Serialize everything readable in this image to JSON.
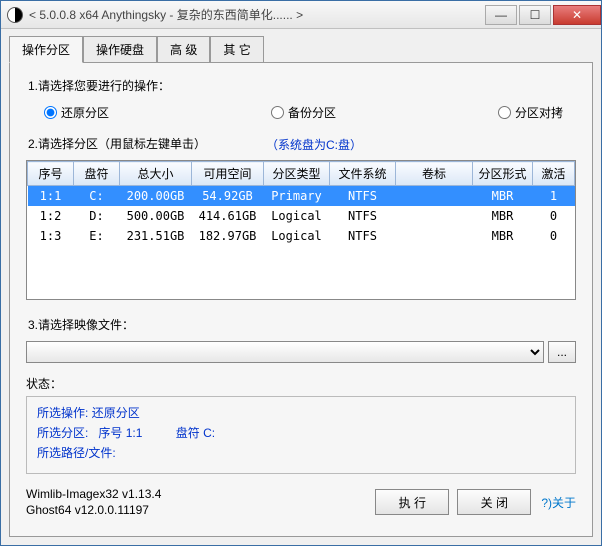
{
  "window": {
    "title": "< 5.0.0.8 x64 Anythingsky - 复杂的东西简单化...... >"
  },
  "tabs": [
    "操作分区",
    "操作硬盘",
    "高 级",
    "其 它"
  ],
  "section1": {
    "label": "1.请选择您要进行的操作：",
    "options": {
      "restore": "还原分区",
      "backup": "备份分区",
      "copy": "分区对拷"
    }
  },
  "section2": {
    "label": "2.请选择分区（用鼠标左键单击）",
    "sysdisk": "（系统盘为C:盘）",
    "headers": [
      "序号",
      "盘符",
      "总大小",
      "可用空间",
      "分区类型",
      "文件系统",
      "卷标",
      "分区形式",
      "激活"
    ],
    "rows": [
      {
        "no": "1:1",
        "drv": "C:",
        "total": "200.00GB",
        "free": "54.92GB",
        "ptype": "Primary",
        "fs": "NTFS",
        "vol": "",
        "scheme": "MBR",
        "act": "1"
      },
      {
        "no": "1:2",
        "drv": "D:",
        "total": "500.00GB",
        "free": "414.61GB",
        "ptype": "Logical",
        "fs": "NTFS",
        "vol": "",
        "scheme": "MBR",
        "act": "0"
      },
      {
        "no": "1:3",
        "drv": "E:",
        "total": "231.51GB",
        "free": "182.97GB",
        "ptype": "Logical",
        "fs": "NTFS",
        "vol": "",
        "scheme": "MBR",
        "act": "0"
      }
    ]
  },
  "section3": {
    "label": "3.请选择映像文件：",
    "browse": "..."
  },
  "status": {
    "label": "状态：",
    "op_label": "所选操作:",
    "op_val": "还原分区",
    "part_label": "所选分区:",
    "part_no_lab": "序号",
    "part_no": "1:1",
    "part_drv_lab": "盘符",
    "part_drv": "C:",
    "path_label": "所选路径/文件:"
  },
  "footer": {
    "v1": "Wimlib-Imagex32 v1.13.4",
    "v2": "Ghost64 v12.0.0.11197",
    "exec": "执 行",
    "close": "关 闭",
    "about": "?)关于"
  }
}
